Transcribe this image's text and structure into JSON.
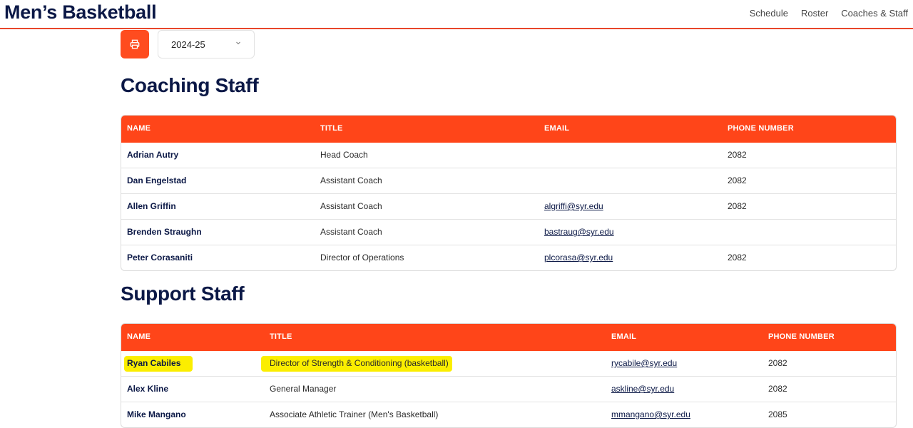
{
  "header": {
    "site_title": "Men’s Basketball",
    "nav": [
      "Schedule",
      "Roster",
      "Coaches & Staff"
    ]
  },
  "toolbar": {
    "print_icon": "printer-icon",
    "season_selected": "2024-25",
    "season_icon": "chevron-down-icon"
  },
  "coaching": {
    "heading": "Coaching Staff",
    "columns": [
      "NAME",
      "TITLE",
      "EMAIL",
      "PHONE NUMBER"
    ],
    "rows": [
      {
        "name": "Adrian Autry",
        "title": "Head Coach",
        "email": "",
        "phone": "2082"
      },
      {
        "name": "Dan Engelstad",
        "title": "Assistant Coach",
        "email": "",
        "phone": "2082"
      },
      {
        "name": "Allen Griffin",
        "title": "Assistant Coach",
        "email": "algriffi@syr.edu",
        "phone": "2082"
      },
      {
        "name": "Brenden Straughn",
        "title": "Assistant Coach",
        "email": "bastraug@syr.edu",
        "phone": ""
      },
      {
        "name": "Peter Corasaniti",
        "title": "Director of Operations",
        "email": "plcorasa@syr.edu",
        "phone": "2082"
      }
    ]
  },
  "support": {
    "heading": "Support Staff",
    "columns": [
      "NAME",
      "TITLE",
      "EMAIL",
      "PHONE NUMBER"
    ],
    "rows": [
      {
        "name": "Ryan Cabiles",
        "title": "Director of Strength & Conditioning (basketball)",
        "email": "rycabile@syr.edu",
        "phone": "2082"
      },
      {
        "name": "Alex Kline",
        "title": "General Manager",
        "email": "askline@syr.edu",
        "phone": "2082"
      },
      {
        "name": "Mike Mangano",
        "title": "Associate Athletic Trainer (Men's Basketball)",
        "email": "mmangano@syr.edu",
        "phone": "2085"
      }
    ]
  },
  "colors": {
    "accent": "#ff4519",
    "navy": "#0b1846",
    "highlight": "#fbee00"
  }
}
